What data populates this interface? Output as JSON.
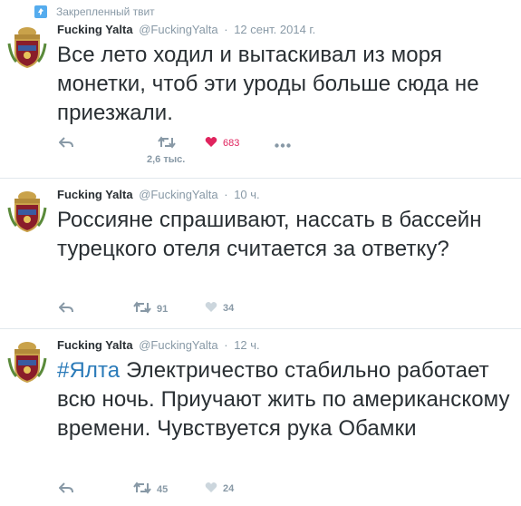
{
  "pinned_label": "Закрепленный твит",
  "colors": {
    "link": "#2b7bb9",
    "muted": "#8899a6",
    "like": "#e0245e",
    "pin": "#55acee"
  },
  "tweets": [
    {
      "name": "Fucking Yalta",
      "handle": "@FuckingYalta",
      "sep": "·",
      "time": "12 сент. 2014 г.",
      "text": "Все лето ходил и вытаскивал из моря монетки, чтоб эти уроды больше сюда не приезжали.",
      "retweets": "",
      "retweets_sub": "2,6 тыс.",
      "likes": "683"
    },
    {
      "name": "Fucking Yalta",
      "handle": "@FuckingYalta",
      "sep": "·",
      "time": "10 ч.",
      "text": "Россияне спрашивают, нассать в бассейн турецкого отеля считается за ответку?",
      "retweets": "91",
      "likes": "34"
    },
    {
      "name": "Fucking Yalta",
      "handle": "@FuckingYalta",
      "sep": "·",
      "time": "12 ч.",
      "hashtag": "#Ялта",
      "text": " Электричество стабильно работает всю ночь. Приучают жить по американскому времени.  Чувствуется рука Обамки",
      "retweets": "45",
      "likes": "24"
    }
  ]
}
